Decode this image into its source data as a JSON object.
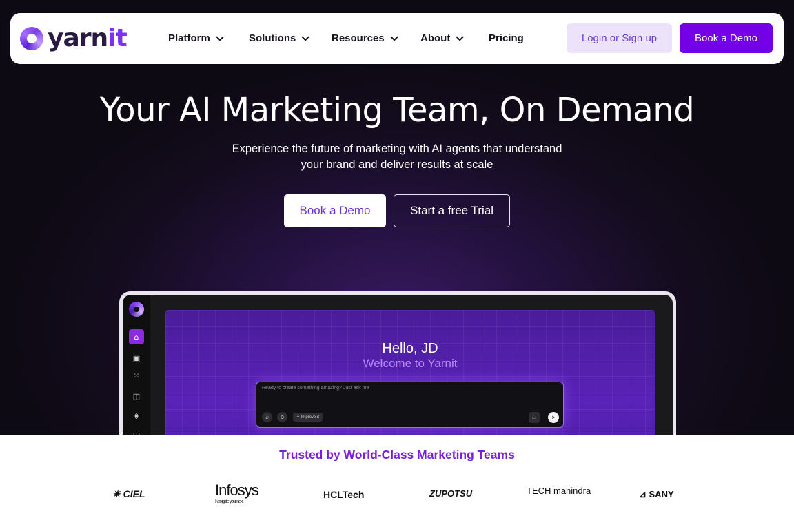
{
  "nav": {
    "logo_text_a": "yarn",
    "logo_text_b": "it",
    "items": [
      {
        "label": "Platform",
        "has_dropdown": true
      },
      {
        "label": "Solutions",
        "has_dropdown": true
      },
      {
        "label": "Resources",
        "has_dropdown": true
      },
      {
        "label": "About",
        "has_dropdown": true
      },
      {
        "label": "Pricing",
        "has_dropdown": false
      }
    ],
    "login_label": "Login or Sign up",
    "demo_label": "Book a Demo"
  },
  "hero": {
    "headline": "Your AI Marketing Team, On Demand",
    "sub_line1": "Experience the future of marketing with AI agents that understand",
    "sub_line2": "your brand and deliver results at scale",
    "demo_button": "Book a Demo",
    "trial_button": "Start a free Trial"
  },
  "mockup": {
    "greeting": "Hello, JD",
    "welcome": "Welcome to Yarnit",
    "prompt_placeholder": "Ready to create something amazing? Just ask me",
    "improve_label": "Improve it",
    "sidebar_icons": [
      "home-icon",
      "image-icon",
      "grid-icon",
      "layout-icon",
      "shapes-icon",
      "briefcase-icon"
    ]
  },
  "trusted": {
    "title": "Trusted by World-Class Marketing Teams",
    "logos": [
      {
        "name": "CIEL"
      },
      {
        "name": "Infosys",
        "tagline": "Navigate your next"
      },
      {
        "name": "HCLTech"
      },
      {
        "name": "ZUPOTSU"
      },
      {
        "name": "TECH mahindra"
      },
      {
        "name": "SANY"
      }
    ]
  },
  "colors": {
    "brand_purple": "#7300e6",
    "login_bg": "#ece3fb",
    "trusted_title": "#7a1fe0",
    "hero_bg": "#140c1e"
  }
}
